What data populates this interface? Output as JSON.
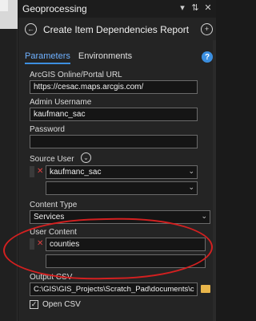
{
  "pane": {
    "title": "Geoprocessing",
    "tool_title": "Create Item Dependencies Report",
    "icons": [
      "chevron-down-icon",
      "pin-icon",
      "close-icon",
      "back-icon",
      "add-icon",
      "help-icon"
    ]
  },
  "tabs": [
    {
      "label": "Parameters",
      "active": true
    },
    {
      "label": "Environments",
      "active": false
    }
  ],
  "form": {
    "portal_label": "ArcGIS Online/Portal URL",
    "portal_value": "https://cesac.maps.arcgis.com/",
    "admin_label": "Admin Username",
    "admin_value": "kaufmanc_sac",
    "password_label": "Password",
    "password_value": "",
    "source_user_label": "Source User",
    "source_user_value": "kaufmanc_sac",
    "content_type_label": "Content Type",
    "content_type_value": "Services",
    "user_content_label": "User Content",
    "user_content_value": "counties",
    "output_csv_label": "Output CSV",
    "output_csv_value": "C:\\GIS\\GIS_Projects\\Scratch_Pad\\documents\\c",
    "open_csv_label": "Open CSV",
    "open_csv_checked": true
  },
  "colors": {
    "accent": "#3d8fe0",
    "annotation": "#d42020",
    "remove": "#e04040",
    "folder": "#e8b54a"
  }
}
